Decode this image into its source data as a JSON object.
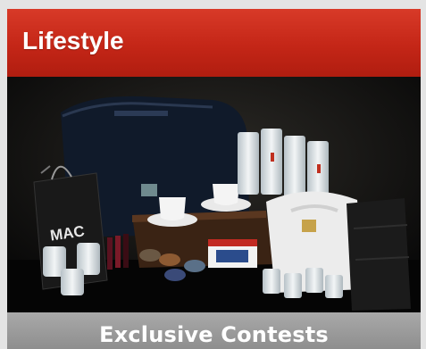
{
  "header": {
    "title": "Lifestyle"
  },
  "product_image": {
    "bag_brand": "MAC"
  },
  "footer": {
    "label": "Exclusive Contests"
  },
  "colors": {
    "header_red": "#c42617",
    "footer_gray": "#9a9a9a"
  }
}
